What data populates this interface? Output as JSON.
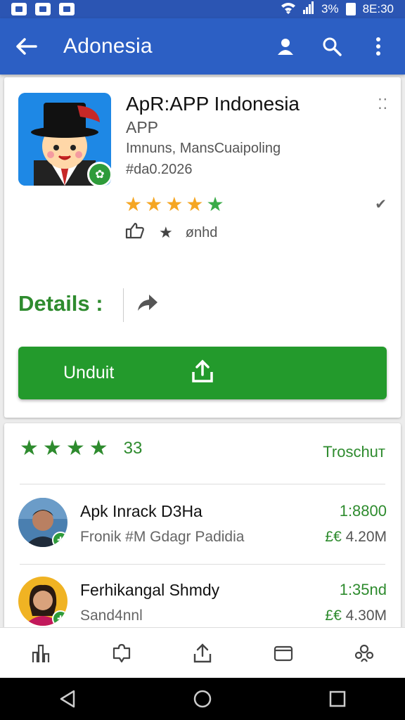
{
  "status_bar": {
    "battery_pct": "3%",
    "time": "8E:30"
  },
  "app_bar": {
    "title": "Adonesia"
  },
  "app": {
    "name": "ApR:APP Indonesia",
    "type": "APP",
    "developer": "Imnuns, MansCuaipoling",
    "date": "#da0.2026",
    "rating_stars": 5,
    "meta_text": "ønhd",
    "details_label": "Details :",
    "download_label": "Unduit"
  },
  "reviews": {
    "count": "33",
    "link": "Troschuт",
    "items": [
      {
        "name": "Apk Inrack D3Ha",
        "sub": "Fronik  #M Gdagr Padidia",
        "time": "1:8800",
        "size_prefix": "£€",
        "size": "4.20M"
      },
      {
        "name": "Ferhikangal Shmdy",
        "sub": "Sand4nnl",
        "time": "1:35nd",
        "size_prefix": "£€",
        "size": "4.30M"
      }
    ]
  },
  "colors": {
    "primary": "#2c5fc4",
    "accent_green": "#239a2c",
    "star_gold": "#f5a623"
  }
}
